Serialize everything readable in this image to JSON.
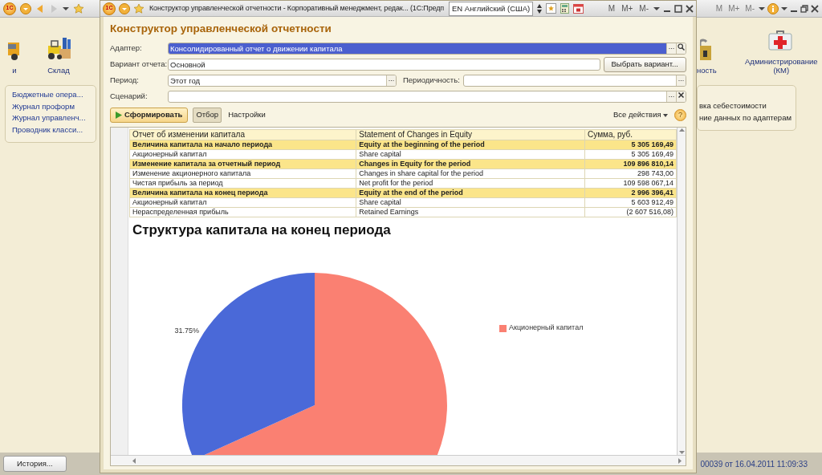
{
  "main_window": {
    "logo": "1С",
    "memory_buttons": [
      {
        "label": "M",
        "disabled": true
      },
      {
        "label": "M+",
        "disabled": true
      },
      {
        "label": "M-",
        "disabled": true
      }
    ],
    "left_sections": [
      {
        "label": "и"
      },
      {
        "label": "Склад"
      }
    ],
    "right_sections": [
      {
        "label": "ность"
      },
      {
        "label": "Администрирование (КМ)"
      }
    ],
    "left_links": [
      "Бюджетные опера...",
      "Журнал проформ",
      "Журнал управленч...",
      "Проводник класси..."
    ],
    "right_links": [
      "вка себестоимости",
      "ние данных по адаптерам"
    ],
    "history_button": "История...",
    "status_text": "00039 от 16.04.2011 11:09:33"
  },
  "report_window": {
    "logo": "1С",
    "title": "Конструктор управленческой отчетности - Корпоративный менеджмент, редак... (1С:Предп",
    "language": "EN Английский (США)",
    "memory_buttons": [
      {
        "label": "M",
        "disabled": false
      },
      {
        "label": "M+",
        "disabled": false
      },
      {
        "label": "M-",
        "disabled": false
      }
    ],
    "heading": "Конструктор управленческой отчетности",
    "field_rows": [
      {
        "fields": [
          {
            "label": "Адаптер:",
            "value": "Консолидированный отчет о движении капитала",
            "selected": true,
            "choice": "...",
            "search": true
          }
        ]
      },
      {
        "fields": [
          {
            "label": "Вариант отчета:",
            "value": "Основной",
            "selected": false
          }
        ],
        "button": "Выбрать вариант..."
      },
      {
        "fields": [
          {
            "label": "Период:",
            "value": "Этот год",
            "selected": false,
            "choice": "..."
          },
          {
            "label": "Периодичность:",
            "selected": false,
            "choice": "..."
          }
        ]
      },
      {
        "fields": [
          {
            "label": "Сценарий:",
            "selected": false,
            "choice": "...",
            "clear": true
          }
        ]
      }
    ],
    "toolbar": {
      "generate": "Сформировать",
      "filter": {
        "label": "Отбор",
        "pressed": true
      },
      "settings": "Настройки",
      "all_actions": "Все действия",
      "help": "?"
    },
    "table": {
      "columns": [
        "Отчет об изменении капитала",
        "Statement of Changes in Equity",
        "Сумма, руб."
      ],
      "rows": [
        {
          "cells": [
            "Величина капитала на начало периода",
            "Equity at the beginning of the period",
            "5 305 169,49"
          ],
          "highlighted": true
        },
        {
          "cells": [
            "Акционерный капитал",
            "Share capital",
            "5 305 169,49"
          ],
          "highlighted": false
        },
        {
          "cells": [
            "Изменение капитала за отчетный период",
            "Changes in Equity for the period",
            "109 896 810,14"
          ],
          "highlighted": true
        },
        {
          "cells": [
            "Изменение акционерного капитала",
            "Changes in share capital for the period",
            "298 743,00"
          ],
          "highlighted": false
        },
        {
          "cells": [
            "Чистая прибыль за период",
            "Net profit for the period",
            "109 598 067,14"
          ],
          "highlighted": false
        },
        {
          "cells": [
            "Величина капитала на конец периода",
            "Equity at the end of the period",
            "2 996 396,41"
          ],
          "highlighted": true
        },
        {
          "cells": [
            "Акционерный капитал",
            "Share capital",
            "5 603 912,49"
          ],
          "highlighted": false
        },
        {
          "cells": [
            "Нераспределенная прибыль",
            "Retained Earnings",
            "(2 607 516,08)"
          ],
          "highlighted": false
        }
      ]
    },
    "chart_data": {
      "type": "pie",
      "title": "Структура капитала на конец периода",
      "categories": [
        "Акционерный капитал",
        null
      ],
      "values": [
        68.25,
        31.75
      ],
      "colors": [
        "#fa8072",
        "#4a69d8"
      ],
      "legend": true,
      "value_labels": [
        null,
        "31.75%"
      ]
    }
  }
}
